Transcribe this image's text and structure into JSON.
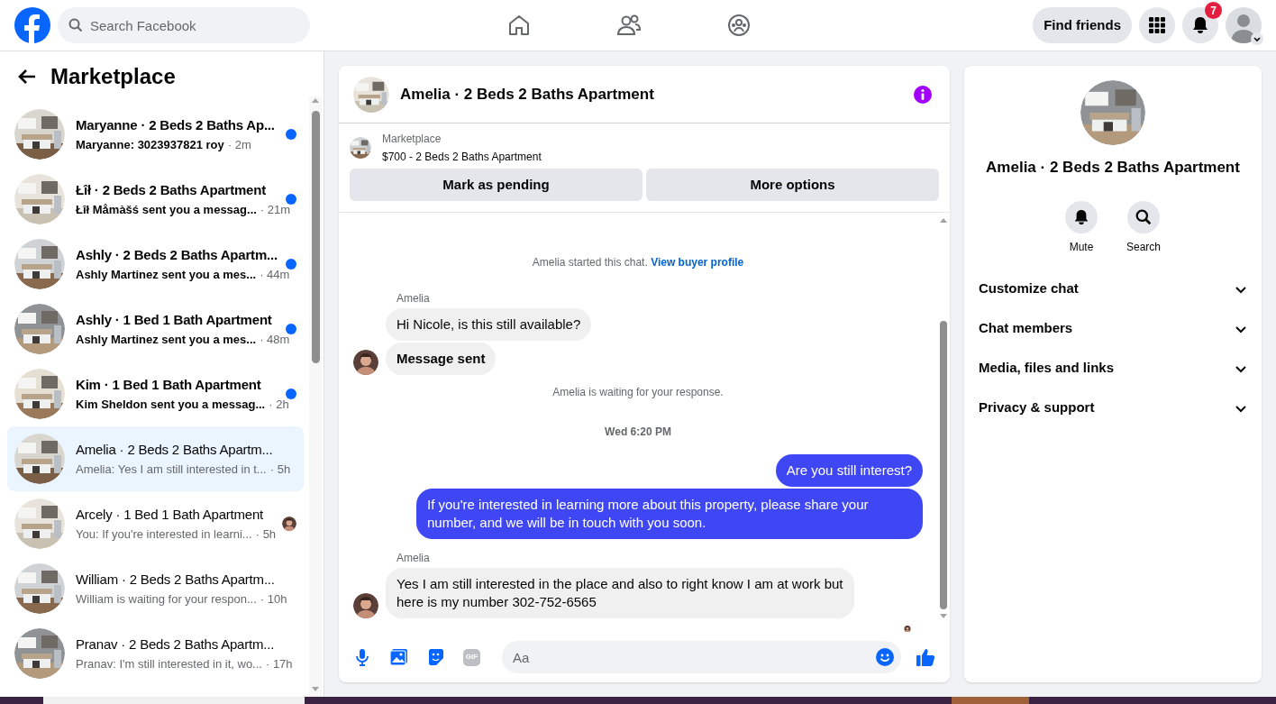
{
  "topbar": {
    "search_placeholder": "Search Facebook",
    "find_friends": "Find friends",
    "notification_count": "7"
  },
  "sidebar": {
    "title": "Marketplace",
    "conversations": [
      {
        "name": "Maryanne · 2 Beds 2 Baths Ap...",
        "preview": "Maryanne: 3023937821 roy",
        "time": "· 2m",
        "unread": true,
        "selected": false,
        "seen": false
      },
      {
        "name": "Łîł · 2 Beds 2 Baths Apartment",
        "preview": "Łîł Måmàšś sent you a messag...",
        "time": "· 21m",
        "unread": true,
        "selected": false,
        "seen": false
      },
      {
        "name": "Ashly · 2 Beds 2 Baths Apartm...",
        "preview": "Ashly Martinez sent you a mes...",
        "time": "· 44m",
        "unread": true,
        "selected": false,
        "seen": false
      },
      {
        "name": "Ashly · 1 Bed 1 Bath Apartment",
        "preview": "Ashly Martinez sent you a mes...",
        "time": "· 48m",
        "unread": true,
        "selected": false,
        "seen": false
      },
      {
        "name": "Kim · 1 Bed 1 Bath Apartment",
        "preview": "Kim Sheldon sent you a messag...",
        "time": "· 2h",
        "unread": true,
        "selected": false,
        "seen": false
      },
      {
        "name": "Amelia · 2 Beds 2 Baths Apartm...",
        "preview": "Amelia: Yes I am still interested in t...",
        "time": "· 5h",
        "unread": false,
        "selected": true,
        "seen": false
      },
      {
        "name": "Arcely · 1 Bed 1 Bath Apartment",
        "preview": "You: If you're interested in learni...",
        "time": "· 5h",
        "unread": false,
        "selected": false,
        "seen": true
      },
      {
        "name": "William · 2 Beds 2 Baths Apartm...",
        "preview": "William is waiting for your respon...",
        "time": "· 10h",
        "unread": false,
        "selected": false,
        "seen": false
      },
      {
        "name": "Pranav · 2 Beds 2 Baths Apartm...",
        "preview": "Pranav: I'm still interested in it, wo...",
        "time": "· 17h",
        "unread": false,
        "selected": false,
        "seen": false
      }
    ]
  },
  "chat": {
    "title": "Amelia · 2 Beds 2 Baths Apartment",
    "listing": {
      "label": "Marketplace",
      "title": "$700 - 2 Beds 2 Baths Apartment"
    },
    "buttons": [
      "Mark as pending",
      "More options"
    ],
    "messages": [
      {
        "kind": "notice",
        "text": "Amelia started this chat.",
        "link": "View buyer profile"
      },
      {
        "kind": "sender",
        "text": "Amelia"
      },
      {
        "kind": "incoming",
        "text": "Hi Nicole, is this still available?",
        "avatar": false,
        "emphasis": false
      },
      {
        "kind": "incoming",
        "text": "Message sent",
        "avatar": true,
        "emphasis": true
      },
      {
        "kind": "notice",
        "text": "Amelia is waiting for your response."
      },
      {
        "kind": "timestamp",
        "text": "Wed 6:20 PM"
      },
      {
        "kind": "outgoing",
        "text": "Are you still interest?"
      },
      {
        "kind": "outgoing",
        "text": "If you're interested in learning more about this property, please share your number, and we will be in touch with you soon."
      },
      {
        "kind": "sender",
        "text": "Amelia"
      },
      {
        "kind": "incoming",
        "text": "Yes I am still interested in the place and also to right know I am at work but here is my number 302-752-6565",
        "avatar": true,
        "emphasis": false
      },
      {
        "kind": "seen"
      }
    ],
    "composer": {
      "placeholder": "Aa",
      "gif_label": "GIF"
    }
  },
  "details": {
    "title": "Amelia · 2 Beds 2 Baths Apartment",
    "actions": [
      {
        "kind": "bell",
        "label": "Mute"
      },
      {
        "kind": "search",
        "label": "Search"
      }
    ],
    "sections": [
      {
        "label": "Customize chat",
        "expanded": false
      },
      {
        "label": "Chat members",
        "expanded": false
      },
      {
        "label": "Media, files and links",
        "expanded": false
      },
      {
        "label": "Privacy & support",
        "expanded": false
      }
    ]
  }
}
